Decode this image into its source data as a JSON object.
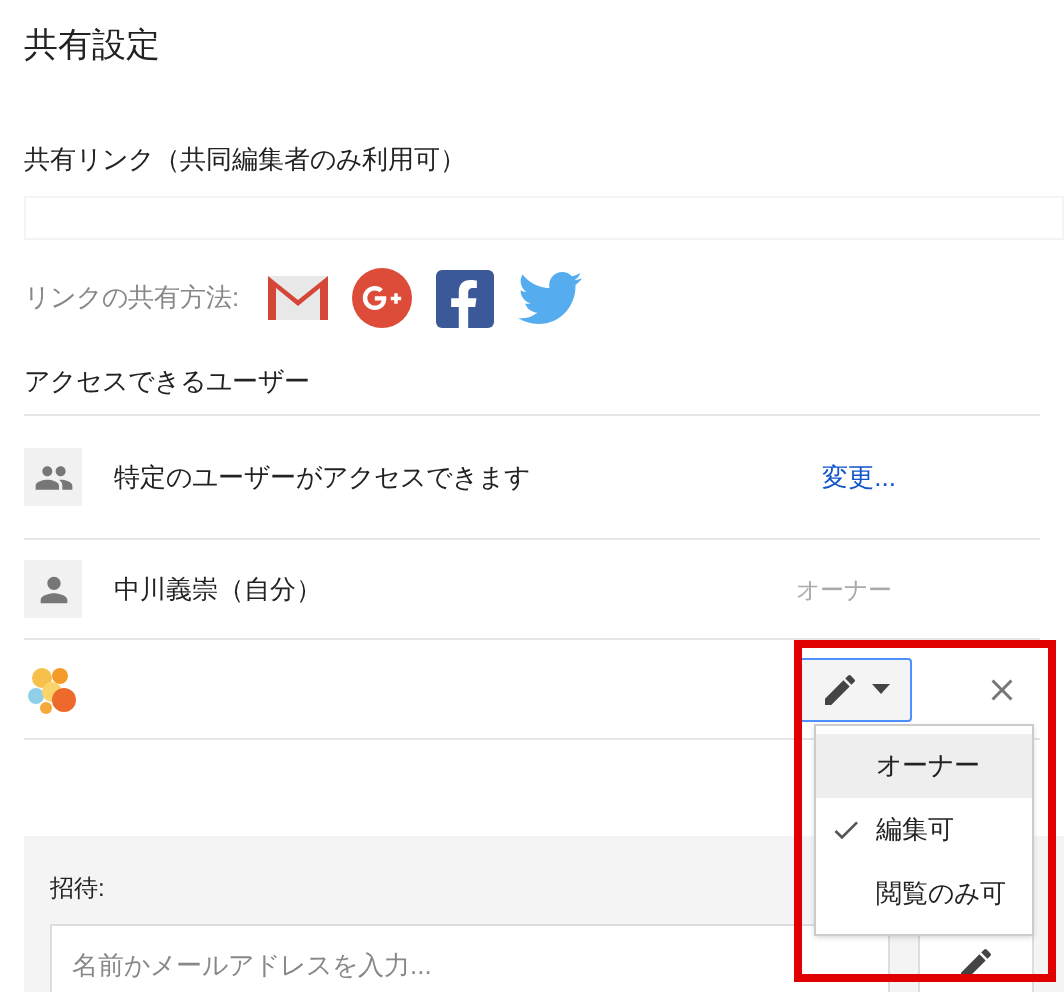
{
  "title": "共有設定",
  "share_link": {
    "label": "共有リンク（共同編集者のみ利用可）"
  },
  "share_via": {
    "label": "リンクの共有方法:",
    "services": [
      {
        "kind": "gmail"
      },
      {
        "kind": "googleplus"
      },
      {
        "kind": "facebook"
      },
      {
        "kind": "twitter"
      }
    ]
  },
  "access": {
    "label": "アクセスできるユーザー",
    "rows": [
      {
        "kind": "group",
        "text": "特定のユーザーがアクセスできます",
        "action": "変更..."
      },
      {
        "kind": "person",
        "name": "中川義崇（自分）",
        "role": "オーナー"
      },
      {
        "kind": "logo",
        "editable": true
      }
    ]
  },
  "permission_menu": {
    "open": true,
    "items": [
      {
        "label": "オーナー",
        "selected": false,
        "highlighted": true
      },
      {
        "label": "編集可",
        "selected": true,
        "highlighted": false
      },
      {
        "label": "閲覧のみ可",
        "selected": false,
        "highlighted": false
      }
    ]
  },
  "invite": {
    "label": "招待:",
    "placeholder": "名前かメールアドレスを入力..."
  }
}
